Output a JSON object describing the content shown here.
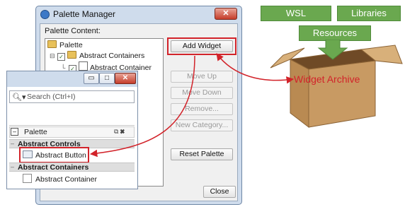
{
  "palette_manager": {
    "title": "Palette Manager",
    "close_glyph": "✕",
    "content_label": "Palette Content:",
    "tree": [
      {
        "label": "Palette",
        "level": 0,
        "icon": "folder-icon"
      },
      {
        "label": "Abstract Containers",
        "level": 1,
        "icon": "folder-icon",
        "checked": true
      },
      {
        "label": "Abstract Container",
        "level": 2,
        "checked": true
      }
    ],
    "buttons": {
      "add_widget": "Add Widget",
      "move_up": "Move Up",
      "move_down": "Move Down",
      "remove": "Remove...",
      "new_category": "New Category...",
      "reset_palette": "Reset Palette",
      "close": "Close"
    }
  },
  "palette_window": {
    "minimize_glyph": "▭",
    "maximize_glyph": "□",
    "close_glyph": "✕",
    "search_placeholder": "Search (Ctrl+I)",
    "palette_label": "Palette",
    "categories": [
      {
        "label": "Abstract Controls",
        "items": [
          "Abstract Button"
        ]
      },
      {
        "label": "Abstract Containers",
        "items": [
          "Abstract Container"
        ]
      }
    ]
  },
  "archive_diagram": {
    "sources": [
      "WSL",
      "Libraries",
      "Resources"
    ],
    "box_label": "Widget Archive"
  },
  "colors": {
    "highlight": "#d2232a",
    "green": "#6aa84f",
    "cardboard": "#c89a63"
  }
}
